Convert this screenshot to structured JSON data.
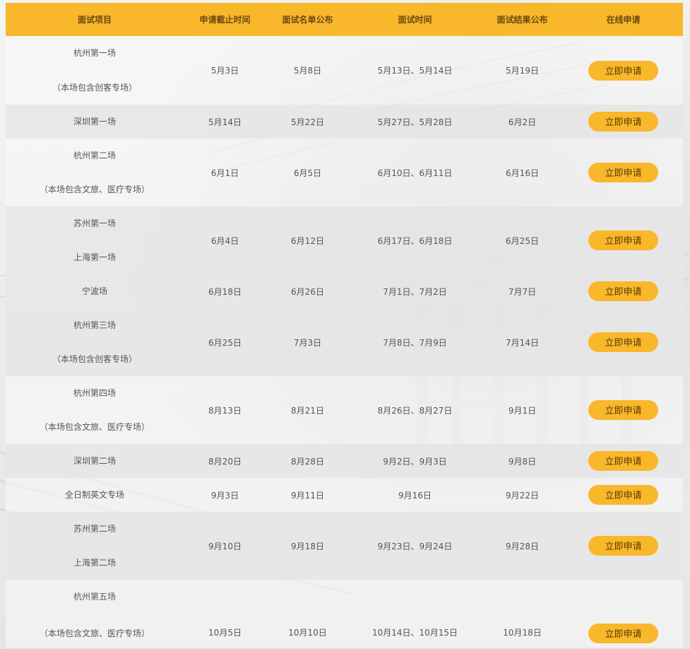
{
  "header": {
    "project": "面试项目",
    "deadline": "申请截止时间",
    "list_publish": "面试名单公布",
    "interview_time": "面试时间",
    "result_publish": "面试结果公布",
    "apply": "在线申请"
  },
  "button_label": "立即申请",
  "colors": {
    "accent": "#f9b72b",
    "shaded_row": "#e6e6e6"
  },
  "rows": [
    {
      "project": [
        "杭州第一场",
        "（本场包含创客专场）"
      ],
      "deadline": "5月3日",
      "list": "5月8日",
      "time": "5月13日、5月14日",
      "result": "5月19日"
    },
    {
      "project": [
        "深圳第一场"
      ],
      "deadline": "5月14日",
      "list": "5月22日",
      "time": "5月27日、5月28日",
      "result": "6月2日"
    },
    {
      "project": [
        "杭州第二场",
        "（本场包含文旅、医疗专场）"
      ],
      "deadline": "6月1日",
      "list": "6月5日",
      "time": "6月10日、6月11日",
      "result": "6月16日"
    },
    {
      "project": [
        "苏州第一场",
        "上海第一场"
      ],
      "deadline": "6月4日",
      "list": "6月12日",
      "time": "6月17日、6月18日",
      "result": "6月25日"
    },
    {
      "project": [
        "宁波场"
      ],
      "deadline": "6月18日",
      "list": "6月26日",
      "time": "7月1日、7月2日",
      "result": "7月7日"
    },
    {
      "project": [
        "杭州第三场",
        "（本场包含创客专场）"
      ],
      "deadline": "6月25日",
      "list": "7月3日",
      "time": "7月8日、7月9日",
      "result": "7月14日"
    },
    {
      "project": [
        "杭州第四场",
        "（本场包含文旅、医疗专场）"
      ],
      "deadline": "8月13日",
      "list": "8月21日",
      "time": "8月26日、8月27日",
      "result": "9月1日"
    },
    {
      "project": [
        "深圳第二场"
      ],
      "deadline": "8月20日",
      "list": "8月28日",
      "time": "9月2日、9月3日",
      "result": "9月8日"
    },
    {
      "project": [
        "全日制英文专场"
      ],
      "deadline": "9月3日",
      "list": "9月11日",
      "time": "9月16日",
      "result": "9月22日"
    },
    {
      "project": [
        "苏州第二场",
        "上海第二场"
      ],
      "deadline": "9月10日",
      "list": "9月18日",
      "time": "9月23日、9月24日",
      "result": "9月28日"
    },
    {
      "project": [
        "杭州第五场",
        "（本场包含文旅、医疗专场）"
      ],
      "deadline": "10月5日",
      "list": "10月10日",
      "time": "10月14日、10月15日",
      "result": "10月18日"
    }
  ]
}
